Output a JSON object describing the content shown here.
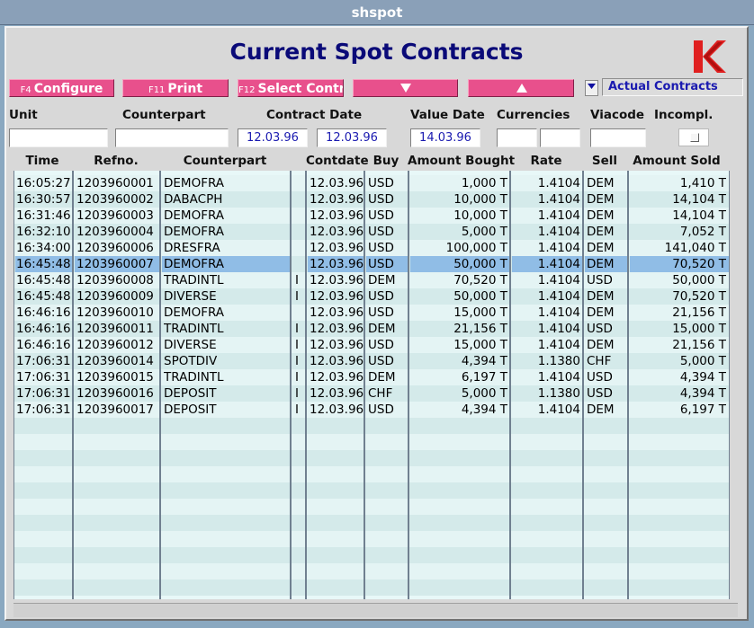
{
  "window": {
    "title": "shspot"
  },
  "header": {
    "title": "Current Spot Contracts",
    "logo_letter": "K"
  },
  "toolbar": {
    "configure": {
      "key": "F4",
      "label": "Configure"
    },
    "print": {
      "key": "F11",
      "label": "Print"
    },
    "select": {
      "key": "F12",
      "label": "Select Contr."
    },
    "down_arrow": "down-arrow",
    "up_arrow": "up-arrow",
    "view_selector": {
      "value": "Actual Contracts"
    }
  },
  "filters": {
    "labels": {
      "unit": "Unit",
      "counterpart": "Counterpart",
      "contract_date": "Contract Date",
      "value_date": "Value Date",
      "currencies": "Currencies",
      "viacode": "Viacode",
      "incompl": "Incompl."
    },
    "values": {
      "unit": "",
      "counterpart": "",
      "contract_date_from": "12.03.96",
      "contract_date_to": "12.03.96",
      "value_date": "14.03.96",
      "currency_1": "",
      "currency_2": "",
      "viacode": ""
    }
  },
  "table": {
    "columns": [
      "Time",
      "Refno.",
      "Counterpart",
      "Contdate",
      "Buy",
      "Amount Bought",
      "Rate",
      "Sell",
      "Amount Sold"
    ],
    "selected_index": 5,
    "rows": [
      [
        "16:05:27",
        "1203960001",
        "DEMOFRA",
        "",
        "12.03.96",
        "USD",
        "1,000 T",
        "1.4104",
        "DEM",
        "1,410 T"
      ],
      [
        "16:30:57",
        "1203960002",
        "DABACPH",
        "",
        "12.03.96",
        "USD",
        "10,000 T",
        "1.4104",
        "DEM",
        "14,104 T"
      ],
      [
        "16:31:46",
        "1203960003",
        "DEMOFRA",
        "",
        "12.03.96",
        "USD",
        "10,000 T",
        "1.4104",
        "DEM",
        "14,104 T"
      ],
      [
        "16:32:10",
        "1203960004",
        "DEMOFRA",
        "",
        "12.03.96",
        "USD",
        "5,000 T",
        "1.4104",
        "DEM",
        "7,052 T"
      ],
      [
        "16:34:00",
        "1203960006",
        "DRESFRA",
        "",
        "12.03.96",
        "USD",
        "100,000 T",
        "1.4104",
        "DEM",
        "141,040 T"
      ],
      [
        "16:45:48",
        "1203960007",
        "DEMOFRA",
        "",
        "12.03.96",
        "USD",
        "50,000 T",
        "1.4104",
        "DEM",
        "70,520 T"
      ],
      [
        "16:45:48",
        "1203960008",
        "TRADINTL",
        "I",
        "12.03.96",
        "DEM",
        "70,520 T",
        "1.4104",
        "USD",
        "50,000 T"
      ],
      [
        "16:45:48",
        "1203960009",
        "DIVERSE",
        "I",
        "12.03.96",
        "USD",
        "50,000 T",
        "1.4104",
        "DEM",
        "70,520 T"
      ],
      [
        "16:46:16",
        "1203960010",
        "DEMOFRA",
        "",
        "12.03.96",
        "USD",
        "15,000 T",
        "1.4104",
        "DEM",
        "21,156 T"
      ],
      [
        "16:46:16",
        "1203960011",
        "TRADINTL",
        "I",
        "12.03.96",
        "DEM",
        "21,156 T",
        "1.4104",
        "USD",
        "15,000 T"
      ],
      [
        "16:46:16",
        "1203960012",
        "DIVERSE",
        "I",
        "12.03.96",
        "USD",
        "15,000 T",
        "1.4104",
        "DEM",
        "21,156 T"
      ],
      [
        "17:06:31",
        "1203960014",
        "SPOTDIV",
        "I",
        "12.03.96",
        "USD",
        "4,394 T",
        "1.1380",
        "CHF",
        "5,000 T"
      ],
      [
        "17:06:31",
        "1203960015",
        "TRADINTL",
        "I",
        "12.03.96",
        "DEM",
        "6,197 T",
        "1.4104",
        "USD",
        "4,394 T"
      ],
      [
        "17:06:31",
        "1203960016",
        "DEPOSIT",
        "I",
        "12.03.96",
        "CHF",
        "5,000 T",
        "1.1380",
        "USD",
        "4,394 T"
      ],
      [
        "17:06:31",
        "1203960017",
        "DEPOSIT",
        "I",
        "12.03.96",
        "USD",
        "4,394 T",
        "1.4104",
        "DEM",
        "6,197 T"
      ]
    ]
  },
  "colors": {
    "accent": "#e8508c",
    "title": "#0a0a78",
    "selection": "#98c4e4",
    "logo": "#e02020"
  }
}
